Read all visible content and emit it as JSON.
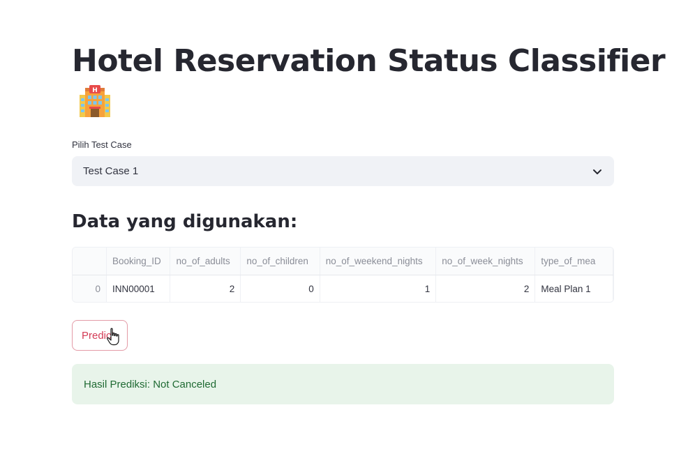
{
  "page": {
    "title": "Hotel Reservation Status Classifier",
    "title_icon": "hotel-emoji"
  },
  "select": {
    "label": "Pilih Test Case",
    "value": "Test Case 1",
    "icon": "chevron-down-icon"
  },
  "subheader": "Data yang digunakan:",
  "table": {
    "columns": [
      "",
      "Booking_ID",
      "no_of_adults",
      "no_of_children",
      "no_of_weekend_nights",
      "no_of_week_nights",
      "type_of_mea"
    ],
    "rows": [
      [
        "0",
        "INN00001",
        "2",
        "0",
        "1",
        "2",
        "Meal Plan 1"
      ]
    ]
  },
  "button": {
    "label": "Predict",
    "cursor": "hand-pointer-icon"
  },
  "result": {
    "text": "Hasil Prediksi: Not Canceled"
  },
  "colors": {
    "accent": "#d33c56",
    "success_bg": "#e8f4ea",
    "success_text": "#1f6a33",
    "select_bg": "#f0f2f6"
  }
}
